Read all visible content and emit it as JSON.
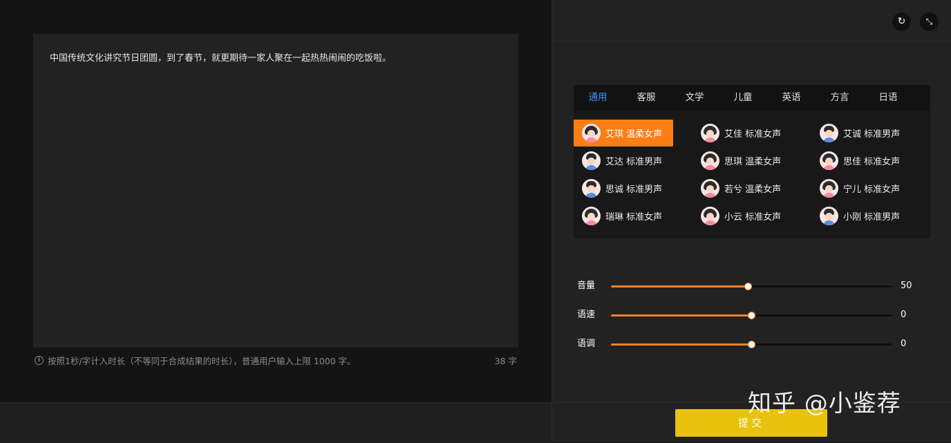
{
  "editor": {
    "text": "中国传统文化讲究节日团圆，到了春节，就更期待一家人聚在一起热热闹闹的吃饭啦。",
    "hint": "按照1秒/字计入时长（不等同于合成结果的时长），普通用户输入上限 1000 字。",
    "count": "38 字"
  },
  "header": {
    "refresh_icon": "refresh-icon",
    "fullscreen_icon": "fullscreen-icon"
  },
  "tabs": [
    {
      "label": "通用",
      "active": true
    },
    {
      "label": "客服"
    },
    {
      "label": "文学"
    },
    {
      "label": "儿童"
    },
    {
      "label": "英语"
    },
    {
      "label": "方言"
    },
    {
      "label": "日语"
    }
  ],
  "voices": [
    {
      "label": "艾琪 温柔女声",
      "gender": "female",
      "selected": true
    },
    {
      "label": "艾佳 标准女声",
      "gender": "female"
    },
    {
      "label": "艾诚 标准男声",
      "gender": "male"
    },
    {
      "label": "艾达 标准男声",
      "gender": "male"
    },
    {
      "label": "思琪 温柔女声",
      "gender": "female"
    },
    {
      "label": "思佳 标准女声",
      "gender": "female"
    },
    {
      "label": "思诚 标准男声",
      "gender": "male"
    },
    {
      "label": "若兮 温柔女声",
      "gender": "female"
    },
    {
      "label": "宁儿 标准女声",
      "gender": "female"
    },
    {
      "label": "瑞琳 标准女声",
      "gender": "female"
    },
    {
      "label": "小云 标准女声",
      "gender": "female"
    },
    {
      "label": "小刚 标准男声",
      "gender": "male"
    }
  ],
  "sliders": [
    {
      "label": "音量",
      "value": "50",
      "fraction": 0.49
    },
    {
      "label": "语速",
      "value": "0",
      "fraction": 0.5
    },
    {
      "label": "语调",
      "value": "0",
      "fraction": 0.5
    }
  ],
  "footer": {
    "submit_label": "提交"
  },
  "watermark": "知乎 @小鉴荐",
  "colors": {
    "accent": "#fa7e15",
    "tab_active": "#3b97f7",
    "submit": "#e9c20c"
  }
}
